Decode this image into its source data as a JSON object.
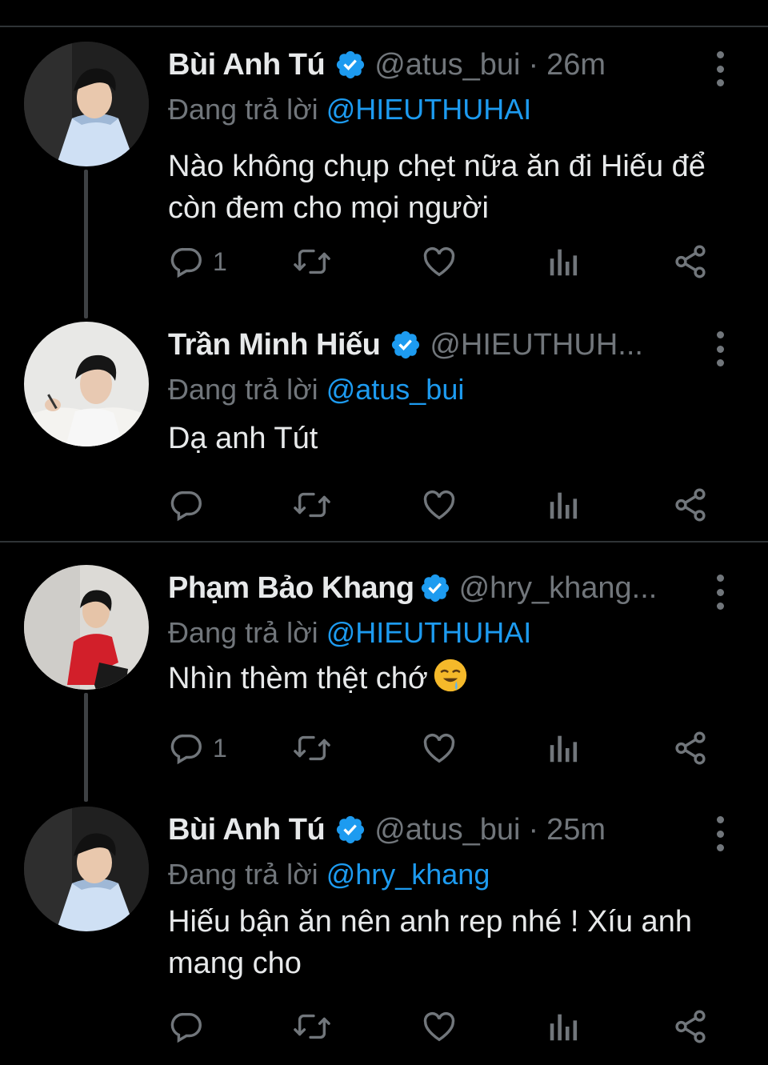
{
  "colors": {
    "background": "#000000",
    "text": "#e7e9ea",
    "muted": "#71767b",
    "accent": "#1d9bf0",
    "divider": "#2f3336"
  },
  "tweets": [
    {
      "name": "Bùi Anh Tú",
      "handle": "@atus_bui",
      "separator": "·",
      "time": "26m",
      "reply_prefix": "Đang trả lời ",
      "reply_to": "@HIEUTHUHAI",
      "text": "Nào không chụp chẹt nữa ăn đi Hiếu để còn đem cho mọi người",
      "reply_count": "1",
      "icons": [
        "verified-badge-icon",
        "more-vertical-icon",
        "reply-icon",
        "retweet-icon",
        "like-icon",
        "analytics-icon",
        "share-icon"
      ]
    },
    {
      "name": "Trần Minh Hiếu",
      "handle": "@HIEUTHUH...",
      "reply_prefix": "Đang trả lời ",
      "reply_to": "@atus_bui",
      "text": "Dạ anh Tút",
      "reply_count": ""
    },
    {
      "name": "Phạm Bảo Khang",
      "handle": "@hry_khang...",
      "reply_prefix": "Đang trả lời ",
      "reply_to": "@HIEUTHUHAI",
      "text": "Nhìn thèm thệt chớ",
      "emoji": "drooling-face-emoji",
      "reply_count": "1"
    },
    {
      "name": "Bùi Anh Tú",
      "handle": "@atus_bui",
      "separator": "·",
      "time": "25m",
      "reply_prefix": "Đang trả lời ",
      "reply_to": "@hry_khang",
      "text": "Hiếu bận ăn nên anh rep nhé ! Xíu anh mang cho",
      "reply_count": ""
    }
  ]
}
